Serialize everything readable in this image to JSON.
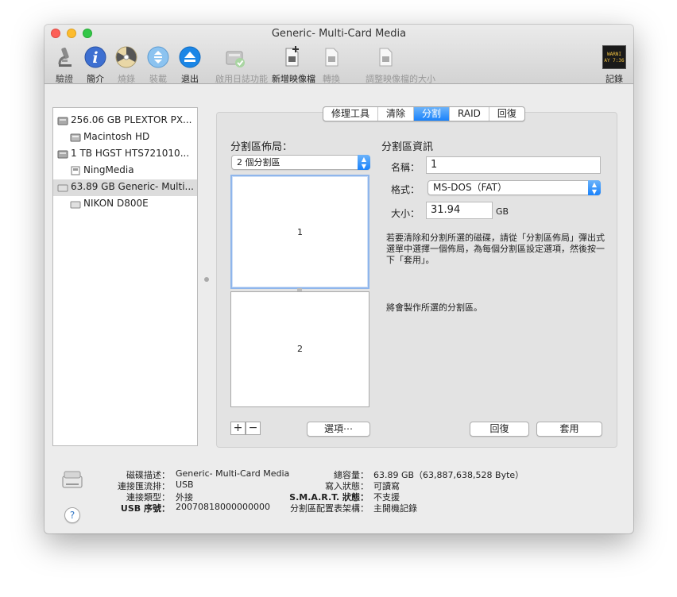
{
  "window": {
    "title": "Generic- Multi-Card Media"
  },
  "toolbar": {
    "buttons": [
      {
        "label": "驗證",
        "icon": "microscope-icon",
        "enabled": true
      },
      {
        "label": "簡介",
        "icon": "info-icon",
        "enabled": true
      },
      {
        "label": "燒錄",
        "icon": "burn-icon",
        "enabled": true
      },
      {
        "label": "裝載",
        "icon": "mount-icon",
        "enabled": true
      },
      {
        "label": "退出",
        "icon": "eject-icon",
        "enabled": true
      },
      {
        "label": "啟用日誌功能",
        "icon": "journal-icon",
        "enabled": false
      },
      {
        "label": "新增映像檔",
        "icon": "new-image-icon",
        "enabled": true
      },
      {
        "label": "轉換",
        "icon": "convert-icon",
        "enabled": false
      },
      {
        "label": "調整映像檔的大小",
        "icon": "resize-image-icon",
        "enabled": false
      }
    ],
    "log": {
      "label": "記錄",
      "icon_text": "WARNI AY 7:36"
    }
  },
  "sidebar": {
    "items": [
      {
        "label": "256.06 GB PLEXTOR PX...",
        "indent": 0,
        "icon": "internal-disk-icon"
      },
      {
        "label": "Macintosh HD",
        "indent": 1,
        "icon": "volume-icon"
      },
      {
        "label": "1 TB HGST HTS721010...",
        "indent": 0,
        "icon": "internal-disk-icon"
      },
      {
        "label": "NingMedia",
        "indent": 1,
        "icon": "volume-icon"
      },
      {
        "label": "63.89 GB Generic- Multi...",
        "indent": 0,
        "icon": "external-disk-icon",
        "selected": true
      },
      {
        "label": "NIKON D800E",
        "indent": 1,
        "icon": "volume-icon"
      }
    ]
  },
  "tabs": [
    "修理工具",
    "清除",
    "分割",
    "RAID",
    "回復"
  ],
  "active_tab": "分割",
  "layout": {
    "heading": "分割區佈局：",
    "selected": "2 個分割區",
    "partitions": [
      "1",
      "2"
    ],
    "plus": "+",
    "minus": "−",
    "options_button": "選項⋯"
  },
  "info": {
    "heading": "分割區資訊",
    "name_label": "名稱：",
    "name_value": "1",
    "format_label": "格式：",
    "format_value": "MS-DOS（FAT）",
    "size_label": "大小：",
    "size_value": "31.94",
    "size_unit": "GB",
    "description_lines": [
      "若要清除和分割所選的磁碟，請從「分割區佈局」彈出式",
      "選單中選擇一個佈局，為每個分割區設定選項，然後按一",
      "下「套用」。"
    ],
    "status": "將會製作所選的分割區。",
    "revert_button": "回復",
    "apply_button": "套用"
  },
  "details": {
    "description_label": "磁碟描述：",
    "description_value": "Generic- Multi-Card Media",
    "bus_label": "連接匯流排：",
    "bus_value": "USB",
    "type_label": "連接類型：",
    "type_value": "外接",
    "serial_label": "USB 序號：",
    "serial_value": "20070818000000000",
    "capacity_label": "總容量：",
    "capacity_value": "63.89 GB（63,887,638,528 Byte）",
    "write_label": "寫入狀態：",
    "write_value": "可讀寫",
    "smart_label": "S.M.A.R.T. 狀態：",
    "smart_value": "不支援",
    "scheme_label": "分割區配置表架構：",
    "scheme_value": "主開機記錄"
  },
  "help": "?"
}
